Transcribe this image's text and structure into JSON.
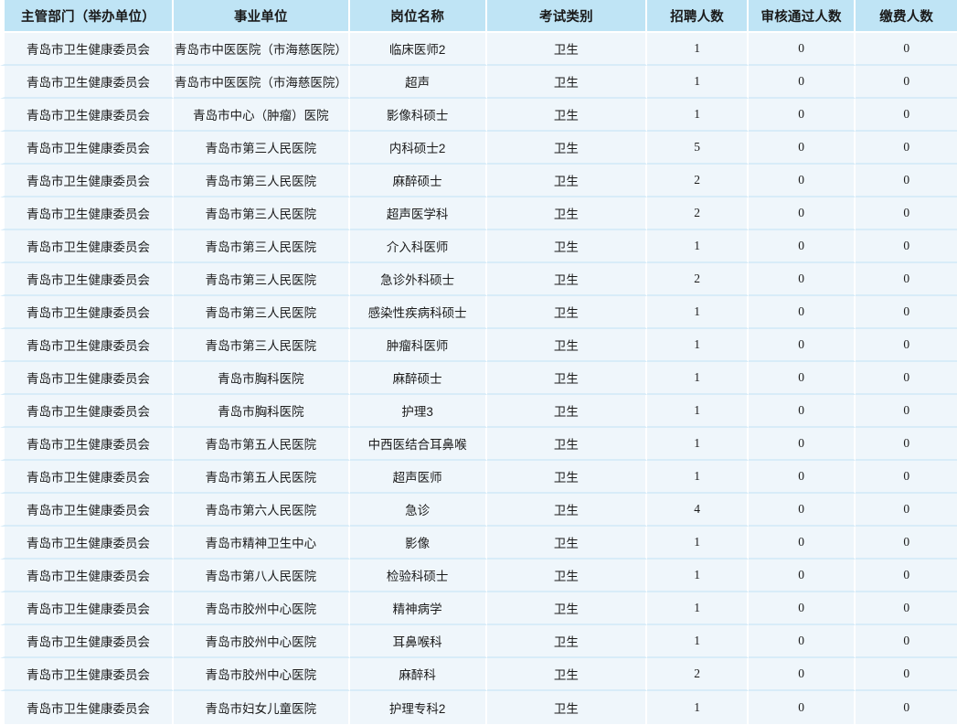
{
  "table": {
    "columns": [
      {
        "key": "dept",
        "label": "主管部门（举办单位）"
      },
      {
        "key": "unit",
        "label": "事业单位"
      },
      {
        "key": "post",
        "label": "岗位名称"
      },
      {
        "key": "exam",
        "label": "考试类别"
      },
      {
        "key": "recruit",
        "label": "招聘人数"
      },
      {
        "key": "approved",
        "label": "审核通过人数"
      },
      {
        "key": "paid",
        "label": "缴费人数"
      }
    ],
    "rows": [
      {
        "dept": "青岛市卫生健康委员会",
        "unit": "青岛市中医医院（市海慈医院）",
        "post": "临床医师2",
        "exam": "卫生",
        "recruit": "1",
        "approved": "0",
        "paid": "0"
      },
      {
        "dept": "青岛市卫生健康委员会",
        "unit": "青岛市中医医院（市海慈医院）",
        "post": "超声",
        "exam": "卫生",
        "recruit": "1",
        "approved": "0",
        "paid": "0"
      },
      {
        "dept": "青岛市卫生健康委员会",
        "unit": "青岛市中心（肿瘤）医院",
        "post": "影像科硕士",
        "exam": "卫生",
        "recruit": "1",
        "approved": "0",
        "paid": "0"
      },
      {
        "dept": "青岛市卫生健康委员会",
        "unit": "青岛市第三人民医院",
        "post": "内科硕士2",
        "exam": "卫生",
        "recruit": "5",
        "approved": "0",
        "paid": "0"
      },
      {
        "dept": "青岛市卫生健康委员会",
        "unit": "青岛市第三人民医院",
        "post": "麻醉硕士",
        "exam": "卫生",
        "recruit": "2",
        "approved": "0",
        "paid": "0"
      },
      {
        "dept": "青岛市卫生健康委员会",
        "unit": "青岛市第三人民医院",
        "post": "超声医学科",
        "exam": "卫生",
        "recruit": "2",
        "approved": "0",
        "paid": "0"
      },
      {
        "dept": "青岛市卫生健康委员会",
        "unit": "青岛市第三人民医院",
        "post": "介入科医师",
        "exam": "卫生",
        "recruit": "1",
        "approved": "0",
        "paid": "0"
      },
      {
        "dept": "青岛市卫生健康委员会",
        "unit": "青岛市第三人民医院",
        "post": "急诊外科硕士",
        "exam": "卫生",
        "recruit": "2",
        "approved": "0",
        "paid": "0"
      },
      {
        "dept": "青岛市卫生健康委员会",
        "unit": "青岛市第三人民医院",
        "post": "感染性疾病科硕士",
        "exam": "卫生",
        "recruit": "1",
        "approved": "0",
        "paid": "0"
      },
      {
        "dept": "青岛市卫生健康委员会",
        "unit": "青岛市第三人民医院",
        "post": "肿瘤科医师",
        "exam": "卫生",
        "recruit": "1",
        "approved": "0",
        "paid": "0"
      },
      {
        "dept": "青岛市卫生健康委员会",
        "unit": "青岛市胸科医院",
        "post": "麻醉硕士",
        "exam": "卫生",
        "recruit": "1",
        "approved": "0",
        "paid": "0"
      },
      {
        "dept": "青岛市卫生健康委员会",
        "unit": "青岛市胸科医院",
        "post": "护理3",
        "exam": "卫生",
        "recruit": "1",
        "approved": "0",
        "paid": "0"
      },
      {
        "dept": "青岛市卫生健康委员会",
        "unit": "青岛市第五人民医院",
        "post": "中西医结合耳鼻喉",
        "exam": "卫生",
        "recruit": "1",
        "approved": "0",
        "paid": "0"
      },
      {
        "dept": "青岛市卫生健康委员会",
        "unit": "青岛市第五人民医院",
        "post": "超声医师",
        "exam": "卫生",
        "recruit": "1",
        "approved": "0",
        "paid": "0"
      },
      {
        "dept": "青岛市卫生健康委员会",
        "unit": "青岛市第六人民医院",
        "post": "急诊",
        "exam": "卫生",
        "recruit": "4",
        "approved": "0",
        "paid": "0"
      },
      {
        "dept": "青岛市卫生健康委员会",
        "unit": "青岛市精神卫生中心",
        "post": "影像",
        "exam": "卫生",
        "recruit": "1",
        "approved": "0",
        "paid": "0"
      },
      {
        "dept": "青岛市卫生健康委员会",
        "unit": "青岛市第八人民医院",
        "post": "检验科硕士",
        "exam": "卫生",
        "recruit": "1",
        "approved": "0",
        "paid": "0"
      },
      {
        "dept": "青岛市卫生健康委员会",
        "unit": "青岛市胶州中心医院",
        "post": "精神病学",
        "exam": "卫生",
        "recruit": "1",
        "approved": "0",
        "paid": "0"
      },
      {
        "dept": "青岛市卫生健康委员会",
        "unit": "青岛市胶州中心医院",
        "post": "耳鼻喉科",
        "exam": "卫生",
        "recruit": "1",
        "approved": "0",
        "paid": "0"
      },
      {
        "dept": "青岛市卫生健康委员会",
        "unit": "青岛市胶州中心医院",
        "post": "麻醉科",
        "exam": "卫生",
        "recruit": "2",
        "approved": "0",
        "paid": "0"
      },
      {
        "dept": "青岛市卫生健康委员会",
        "unit": "青岛市妇女儿童医院",
        "post": "护理专科2",
        "exam": "卫生",
        "recruit": "1",
        "approved": "0",
        "paid": "0"
      }
    ]
  },
  "colors": {
    "header_bg": "#bfe4f5",
    "row_bg": "#eff6fb",
    "grid": "#d8ecf8",
    "text": "#1b1b1b"
  }
}
